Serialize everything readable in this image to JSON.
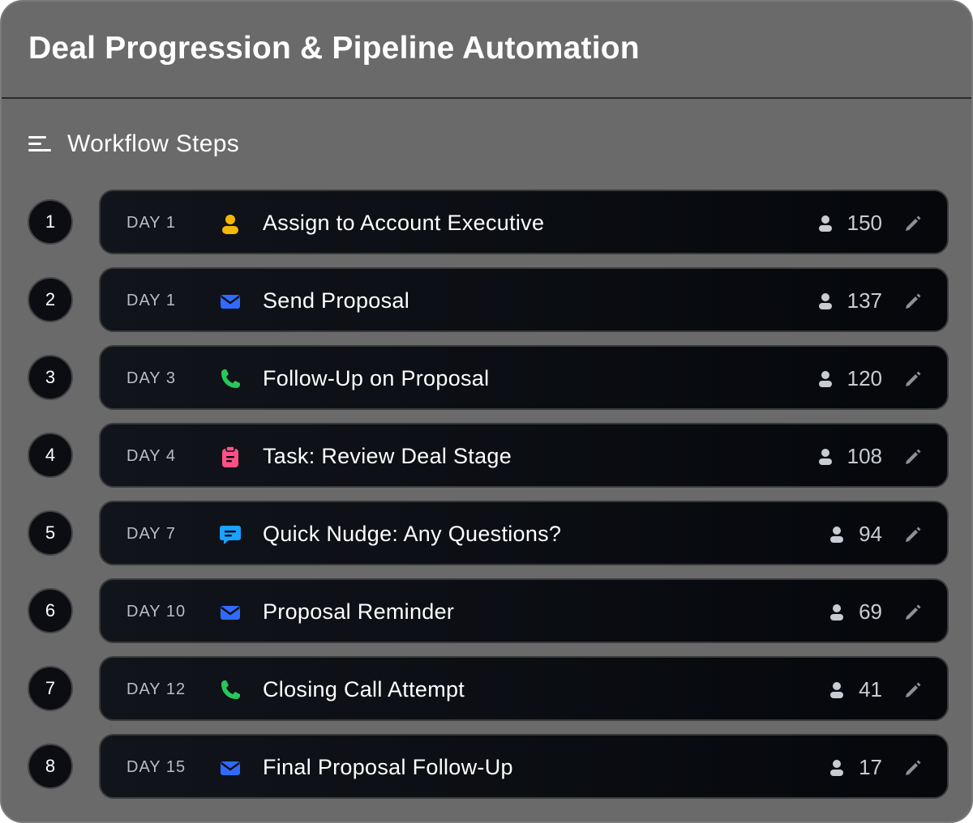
{
  "header": {
    "title": "Deal Progression & Pipeline Automation"
  },
  "section": {
    "title": "Workflow Steps",
    "icon": "menu-icon"
  },
  "colors": {
    "person": "#f5b800",
    "mail": "#2f6bff",
    "phone": "#28c75a",
    "task": "#ff4f86",
    "chat": "#1ba1ff"
  },
  "steps": [
    {
      "number": "1",
      "day": "DAY 1",
      "icon": "person-icon",
      "label": "Assign to Account Executive",
      "count": "150"
    },
    {
      "number": "2",
      "day": "DAY 1",
      "icon": "mail-icon",
      "label": "Send Proposal",
      "count": "137"
    },
    {
      "number": "3",
      "day": "DAY 3",
      "icon": "phone-icon",
      "label": "Follow-Up on Proposal",
      "count": "120"
    },
    {
      "number": "4",
      "day": "DAY 4",
      "icon": "task-icon",
      "label": "Task: Review Deal Stage",
      "count": "108"
    },
    {
      "number": "5",
      "day": "DAY 7",
      "icon": "chat-icon",
      "label": "Quick Nudge: Any Questions?",
      "count": "94"
    },
    {
      "number": "6",
      "day": "DAY 10",
      "icon": "mail-icon",
      "label": "Proposal Reminder",
      "count": "69"
    },
    {
      "number": "7",
      "day": "DAY 12",
      "icon": "phone-icon",
      "label": "Closing Call Attempt",
      "count": "41"
    },
    {
      "number": "8",
      "day": "DAY 15",
      "icon": "mail-icon",
      "label": "Final Proposal Follow-Up",
      "count": "17"
    }
  ]
}
